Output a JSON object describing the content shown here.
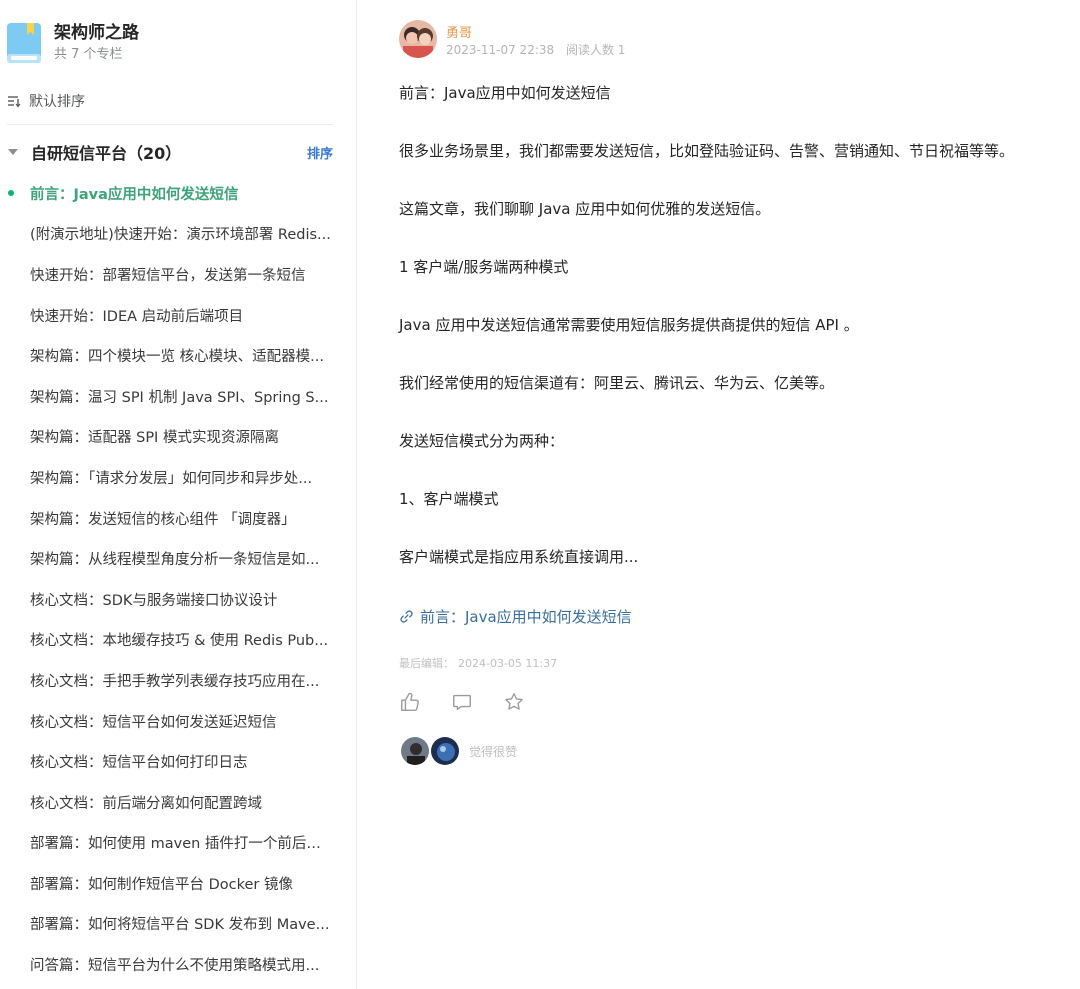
{
  "book": {
    "title": "架构师之路",
    "subtitle": "共 7 个专栏",
    "icon": "book-icon",
    "color": "#6fc3ef"
  },
  "sort": {
    "icon": "sort-icon",
    "label": "默认排序"
  },
  "group": {
    "title": "自研短信平台（20）",
    "sort_label": "排序"
  },
  "docs": [
    {
      "title": "前言：Java应用中如何发送短信",
      "active": true
    },
    {
      "title": "(附演示地址)快速开始：演示环境部署 Redis..."
    },
    {
      "title": "快速开始：部署短信平台，发送第一条短信"
    },
    {
      "title": "快速开始：IDEA 启动前后端项目"
    },
    {
      "title": "架构篇：四个模块一览 核心模块、适配器模..."
    },
    {
      "title": "架构篇：温习 SPI 机制 Java SPI、Spring S..."
    },
    {
      "title": "架构篇：适配器 SPI 模式实现资源隔离"
    },
    {
      "title": "架构篇：「请求分发层」如何同步和异步处..."
    },
    {
      "title": "架构篇：发送短信的核心组件 「调度器」"
    },
    {
      "title": "架构篇：从线程模型角度分析一条短信是如..."
    },
    {
      "title": "核心文档：SDK与服务端接口协议设计"
    },
    {
      "title": "核心文档：本地缓存技巧 & 使用 Redis Pub..."
    },
    {
      "title": "核心文档：手把手教学列表缓存技巧应用在..."
    },
    {
      "title": "核心文档：短信平台如何发送延迟短信"
    },
    {
      "title": "核心文档：短信平台如何打印日志"
    },
    {
      "title": "核心文档：前后端分离如何配置跨域"
    },
    {
      "title": "部署篇：如何使用 maven 插件打一个前后端..."
    },
    {
      "title": "部署篇：如何制作短信平台 Docker 镜像"
    },
    {
      "title": "部署篇：如何将短信平台 SDK 发布到 Mave..."
    },
    {
      "title": "问答篇：短信平台为什么不使用策略模式用..."
    }
  ],
  "author": {
    "name": "勇哥",
    "date": "2023-11-07 22:38",
    "read_count": "阅读人数 1"
  },
  "article": {
    "paragraphs": [
      "前言：Java应用中如何发送短信",
      "很多业务场景里，我们都需要发送短信，比如登陆验证码、告警、营销通知、节日祝福等等。",
      "这篇文章，我们聊聊 Java 应用中如何优雅的发送短信。",
      "1 客户端/服务端两种模式",
      "Java 应用中发送短信通常需要使用短信服务提供商提供的短信 API 。",
      "我们经常使用的短信渠道有：阿里云、腾讯云、华为云、亿美等。",
      "发送短信模式分为两种：",
      "1、客户端模式",
      "客户端模式是指应用系统直接调用..."
    ],
    "link_text": "前言：Java应用中如何发送短信",
    "last_edit_label": "最后编辑：",
    "last_edit_time": "2024-03-05 11:37"
  },
  "actions": {
    "like_icon": "thumbs-up-icon",
    "comment_icon": "comment-icon",
    "star_icon": "star-icon"
  },
  "likers": {
    "text": "觉得很赞"
  },
  "colors": {
    "active_doc": "#3ea37a",
    "author_name": "#e8964b",
    "link": "#3a6e9c",
    "sort_link": "#3b7bd1"
  }
}
